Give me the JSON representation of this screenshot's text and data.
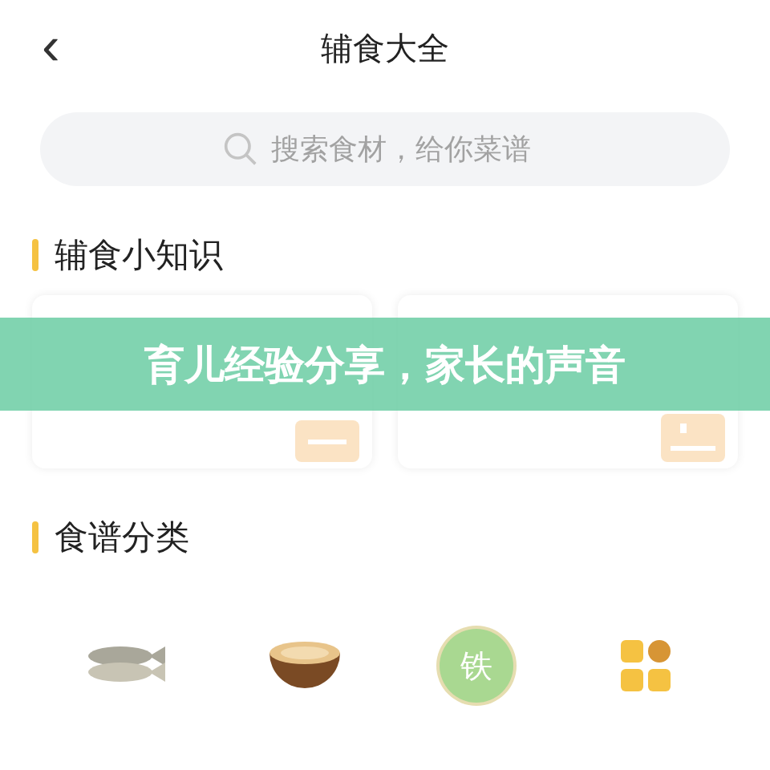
{
  "header": {
    "back": "‹",
    "title": "辅食大全"
  },
  "search": {
    "placeholder": "搜索食材，给你菜谱"
  },
  "tips": {
    "title": "辅食小知识",
    "cards": [
      {
        "kind": "bowl"
      },
      {
        "kind": "plate"
      }
    ]
  },
  "banner": {
    "text": "育儿经验分享，家长的声音"
  },
  "categories": {
    "title": "食谱分类",
    "items": [
      {
        "kind": "fish"
      },
      {
        "kind": "soup"
      },
      {
        "kind": "iron",
        "mark": "铁"
      },
      {
        "kind": "grid"
      }
    ]
  }
}
